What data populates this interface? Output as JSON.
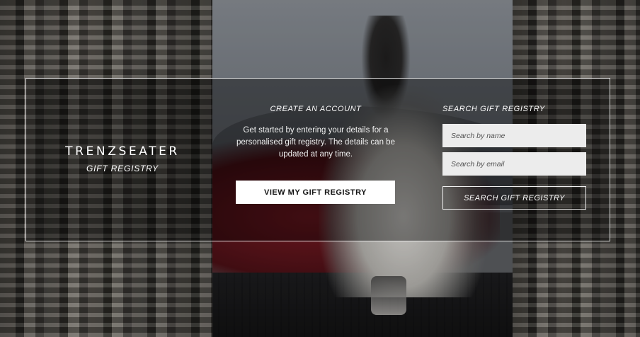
{
  "brand": {
    "name": "TRENZSEATER",
    "subtitle": "GIFT REGISTRY"
  },
  "create_account": {
    "title": "CREATE AN ACCOUNT",
    "description": "Get started by entering your details for a personalised gift registry. The details can be updated at any time.",
    "button_label": "VIEW MY GIFT REGISTRY"
  },
  "search_registry": {
    "title": "SEARCH GIFT REGISTRY",
    "name_placeholder": "Search by name",
    "email_placeholder": "Search by email",
    "button_label": "SEARCH GIFT REGISTRY"
  },
  "colors": {
    "panel_border": "#ffffff",
    "button_bg": "#ffffff",
    "button_text": "#141414",
    "input_bg": "#ececec"
  }
}
